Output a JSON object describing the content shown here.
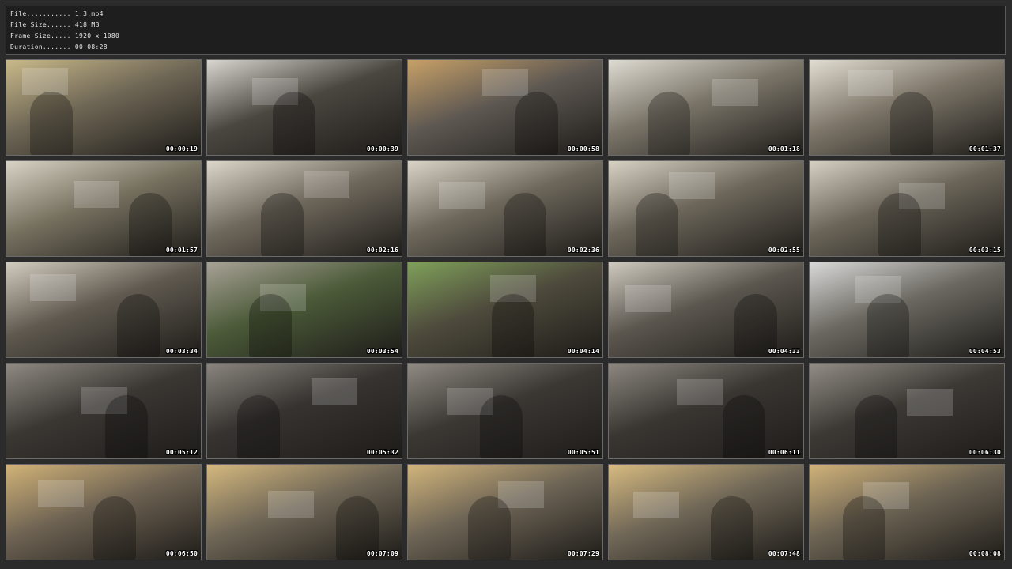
{
  "info": {
    "file_label": "File...........",
    "file_value": "1.3.mp4",
    "size_label": "File Size......",
    "size_value": "418 MB",
    "frame_label": "Frame Size.....",
    "frame_value": "1920 x 1080",
    "duration_label": "Duration.......",
    "duration_value": "00:08:28"
  },
  "thumbnails": [
    {
      "timestamp": "00:00:19",
      "tone": "#6e6655",
      "accent": "#c9b98a"
    },
    {
      "timestamp": "00:00:39",
      "tone": "#4a4640",
      "accent": "#d8d6cf"
    },
    {
      "timestamp": "00:00:58",
      "tone": "#5e5852",
      "accent": "#c7a067"
    },
    {
      "timestamp": "00:01:18",
      "tone": "#7a7468",
      "accent": "#dedbd2"
    },
    {
      "timestamp": "00:01:37",
      "tone": "#7c7568",
      "accent": "#e2ddd2"
    },
    {
      "timestamp": "00:01:57",
      "tone": "#76705f",
      "accent": "#d9d3c6"
    },
    {
      "timestamp": "00:02:16",
      "tone": "#6f685c",
      "accent": "#ddd7cb"
    },
    {
      "timestamp": "00:02:36",
      "tone": "#6d675b",
      "accent": "#dad4c8"
    },
    {
      "timestamp": "00:02:55",
      "tone": "#6c665a",
      "accent": "#d8d2c5"
    },
    {
      "timestamp": "00:03:15",
      "tone": "#6a6458",
      "accent": "#d6d0c4"
    },
    {
      "timestamp": "00:03:34",
      "tone": "#5f594f",
      "accent": "#d2ccc0"
    },
    {
      "timestamp": "00:03:54",
      "tone": "#4b5a38",
      "accent": "#a7a196"
    },
    {
      "timestamp": "00:04:14",
      "tone": "#4e4a3c",
      "accent": "#7fa05a"
    },
    {
      "timestamp": "00:04:33",
      "tone": "#5b564e",
      "accent": "#cfcabf"
    },
    {
      "timestamp": "00:04:53",
      "tone": "#6a6860",
      "accent": "#d9d9d9"
    },
    {
      "timestamp": "00:05:12",
      "tone": "#3a3733",
      "accent": "#8f8a82"
    },
    {
      "timestamp": "00:05:32",
      "tone": "#363330",
      "accent": "#8a857e"
    },
    {
      "timestamp": "00:05:51",
      "tone": "#3b3834",
      "accent": "#908b83"
    },
    {
      "timestamp": "00:06:11",
      "tone": "#393632",
      "accent": "#8c877f"
    },
    {
      "timestamp": "00:06:30",
      "tone": "#3c3935",
      "accent": "#928d85"
    },
    {
      "timestamp": "00:06:50",
      "tone": "#6e6353",
      "accent": "#d2b378"
    },
    {
      "timestamp": "00:07:09",
      "tone": "#6f6656",
      "accent": "#d4b87e"
    },
    {
      "timestamp": "00:07:29",
      "tone": "#6d6455",
      "accent": "#d1b47b"
    },
    {
      "timestamp": "00:07:48",
      "tone": "#706757",
      "accent": "#d6ba80"
    },
    {
      "timestamp": "00:08:08",
      "tone": "#6c6353",
      "accent": "#d0b279"
    }
  ]
}
